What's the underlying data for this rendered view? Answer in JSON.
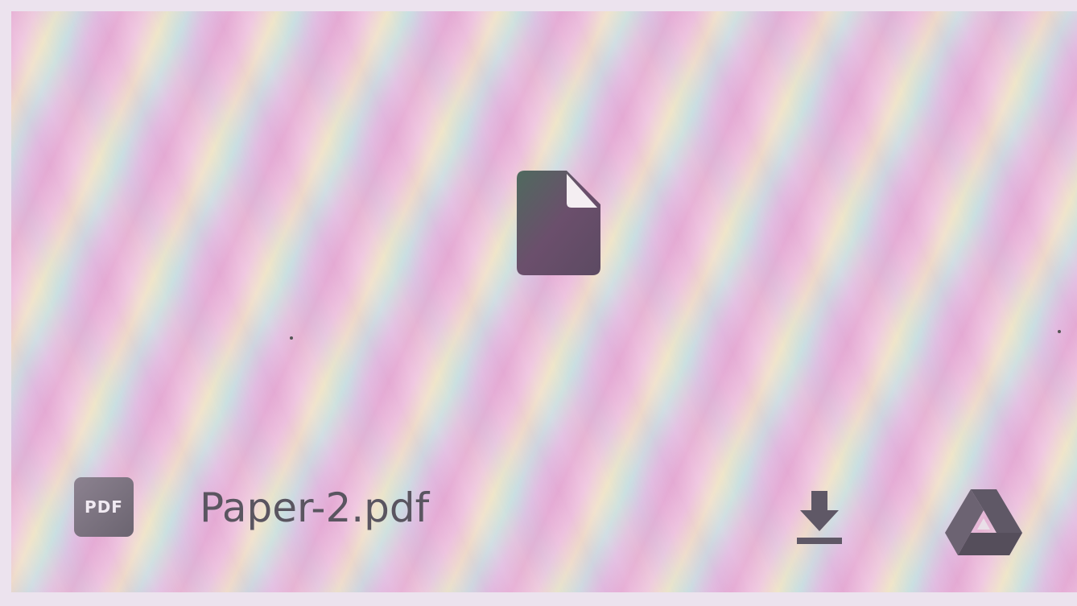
{
  "file": {
    "name": "Paper-2.pdf",
    "type_badge": "PDF"
  },
  "icons": {
    "preview": "file-icon",
    "download": "download-icon",
    "drive": "google-drive-icon"
  },
  "colors": {
    "icon_dark": "#5f5866",
    "badge": "#7a727f",
    "text": "#5a5560"
  }
}
